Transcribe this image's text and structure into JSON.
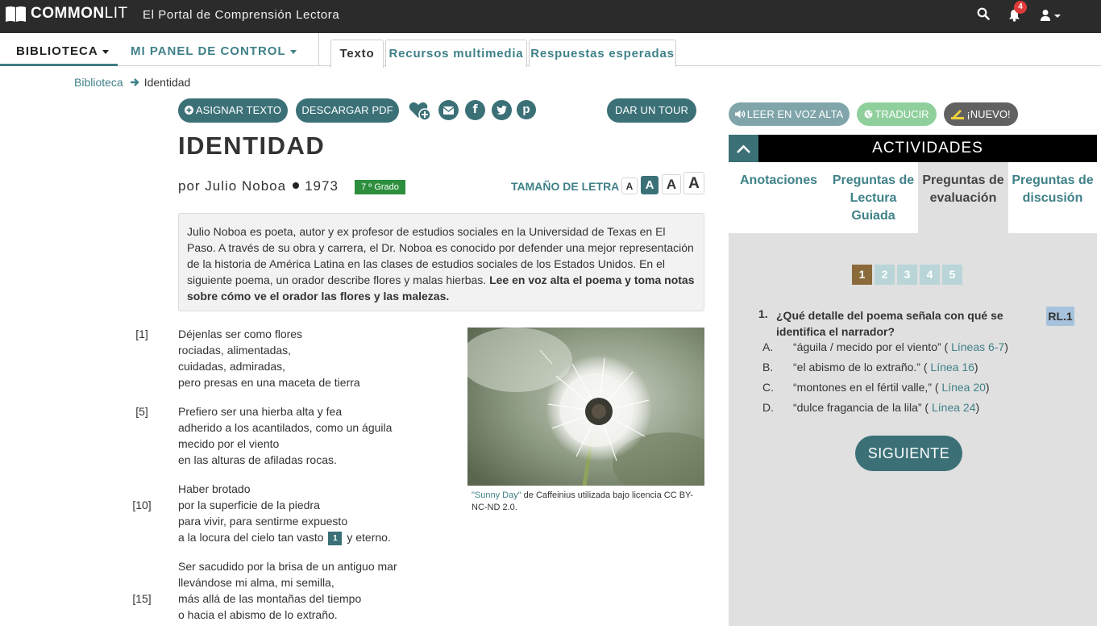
{
  "app": {
    "logo_bold": "COMMON",
    "logo_light": "LIT",
    "tagline": "El Portal de Comprensión Lectora",
    "notifications_count": "4"
  },
  "nav": {
    "biblioteca": "BIBLIOTECA",
    "panel": "MI PANEL DE CONTROL"
  },
  "tabs": [
    {
      "label": "Texto"
    },
    {
      "label": "Recursos multimedia"
    },
    {
      "label": "Respuestas esperadas"
    }
  ],
  "breadcrumb": {
    "link": "Biblioteca",
    "current": "Identidad"
  },
  "actions": {
    "asignar": "ASIGNAR TEXTO",
    "pdf": "DESCARGAR PDF",
    "tour": "DAR UN TOUR"
  },
  "text": {
    "title": "IDENTIDAD",
    "author": "por Julio Noboa",
    "year": "1973",
    "grade": "7 º Grado",
    "font_size_label": "TAMAÑO DE LETRA",
    "font_sizes": [
      "A",
      "A",
      "A",
      "A"
    ],
    "intro_plain": "Julio Noboa es poeta, autor y ex profesor de estudios sociales en la Universidad de Texas en El Paso. A través de su obra y carrera, el Dr. Noboa es conocido por defender una mejor representación de la historia de América Latina en las clases de estudios sociales de los Estados Unidos. En el siguiente poema, un orador describe flores y malas hierbas. ",
    "intro_bold": "Lee en voz alta el poema y toma notas sobre cómo ve el orador las flores y las malezas."
  },
  "poem": {
    "line_numbers": [
      "[1]",
      "[5]",
      "[10]",
      "[15]"
    ],
    "lines": [
      "Déjenlas ser como flores",
      "rociadas, alimentadas,",
      "cuidadas, admiradas,",
      "pero presas en una maceta de tierra",
      "Prefiero ser una hierba alta y fea",
      "adherido a los acantilados, como un águila",
      "mecido por el viento",
      "en las alturas de afiladas rocas.",
      "Haber brotado",
      "por la superficie de la piedra",
      "para vivir, para sentirme expuesto",
      "a la locura del cielo tan vasto",
      "Ser sacudido por la brisa de un antiguo mar",
      "llevándose mi alma, mi semilla,",
      "más allá de las montañas del tiempo",
      "o hacia el abismo de lo extraño."
    ],
    "line12_tail": "y eterno.",
    "footnote": "1"
  },
  "image": {
    "caption_link": "\"Sunny Day\"",
    "caption_text": " de Caffeinius utilizada bajo licencia CC BY-NC-ND 2.0."
  },
  "right": {
    "leer": "LEER EN VOZ ALTA",
    "traducir": "TRADUCIR",
    "nuevo": "¡NUEVO!",
    "activities_title": "ACTIVIDADES",
    "activity_tabs": [
      {
        "label": "Anotaciones"
      },
      {
        "label": "Preguntas de Lectura Guiada"
      },
      {
        "label": "Preguntas de evaluación"
      },
      {
        "label": "Preguntas de discusión"
      }
    ],
    "pages": [
      "1",
      "2",
      "3",
      "4",
      "5"
    ],
    "question": {
      "number": "1.",
      "text": "¿Qué detalle del poema señala con qué se identifica el narrador?",
      "standard": "RL.1",
      "options": [
        {
          "letter": "A.",
          "text": "“águila / mecido por el viento” ( ",
          "link": "Líneas 6-7",
          "end": ")"
        },
        {
          "letter": "B.",
          "text": "“el abismo de lo extraño.” ( ",
          "link": "Línea 16",
          "end": ")"
        },
        {
          "letter": "C.",
          "text": "“montones en el fértil valle,” ( ",
          "link": "Línea 20",
          "end": ")"
        },
        {
          "letter": "D.",
          "text": "“dulce fragancia de la lila” ( ",
          "link": "Línea 24",
          "end": ")"
        }
      ]
    },
    "next": "SIGUIENTE"
  },
  "colors": {
    "teal": "#3b7077",
    "topbar": "#2b2b2b",
    "grade_green": "#2d8f3d",
    "current_page": "#8a6a3a"
  }
}
